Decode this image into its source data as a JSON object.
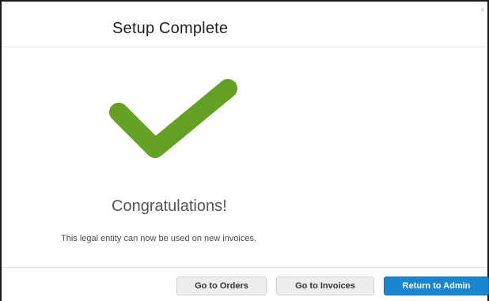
{
  "dialog": {
    "title": "Setup Complete",
    "close_glyph": "×"
  },
  "body": {
    "icon": "checkmark-icon",
    "icon_color": "#62a124",
    "heading": "Congratulations!",
    "message": "This legal entity can now be used on new invoices."
  },
  "footer": {
    "buttons": [
      {
        "label": "Go to Orders",
        "style": "secondary"
      },
      {
        "label": "Go to Invoices",
        "style": "secondary"
      },
      {
        "label": "Return to Admin",
        "style": "primary",
        "color": "#1a85d0"
      }
    ]
  }
}
